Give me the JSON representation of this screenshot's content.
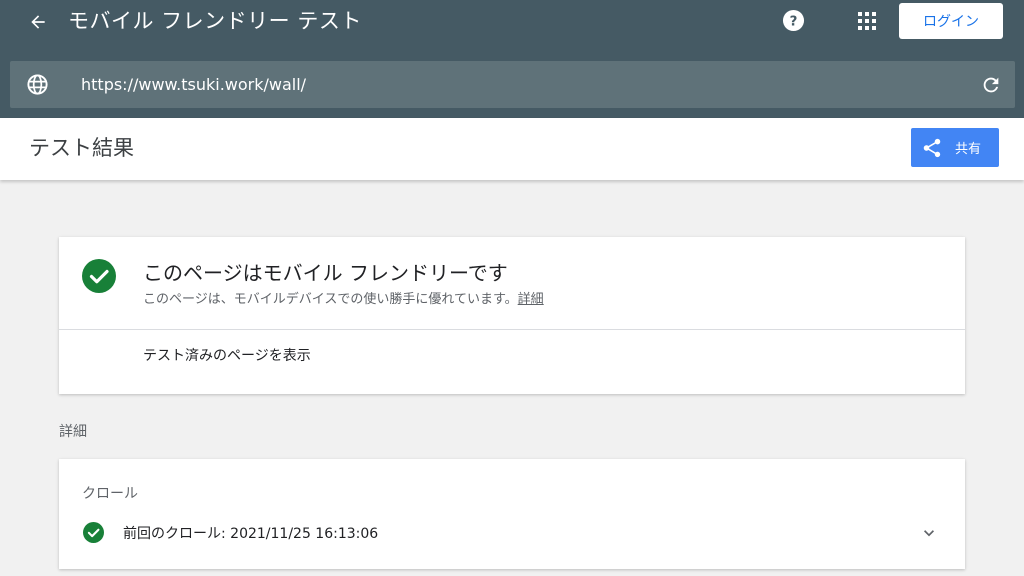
{
  "app": {
    "title": "モバイル フレンドリー テスト",
    "login_label": "ログイン",
    "icons": {
      "back": "arrow-back-icon",
      "help": "help-icon",
      "apps": "apps-grid-icon"
    }
  },
  "url_bar": {
    "url": "https://www.tsuki.work/wall/",
    "icons": {
      "globe": "globe-icon",
      "reload": "reload-icon"
    }
  },
  "result_header": {
    "title": "テスト結果",
    "share_label": "共有",
    "share_icon": "share-icon"
  },
  "summary_card": {
    "status_title": "このページはモバイル フレンドリーです",
    "status_subtitle": "このページは、モバイルデバイスでの使い勝手に優れています。",
    "details_link": "詳細",
    "view_tested_page": "テスト済みのページを表示",
    "status_icon": "check-circle-icon"
  },
  "details_section": {
    "label": "詳細"
  },
  "crawl_card": {
    "label": "クロール",
    "last_crawl": "前回のクロール: 2021/11/25 16:13:06",
    "status_icon": "check-circle-icon",
    "expand_icon": "chevron-down-icon"
  },
  "colors": {
    "topbar": "#455a64",
    "url_bar": "#5f7279",
    "accent_blue": "#4285f4",
    "success_green": "#188038",
    "background": "#f1f1f1"
  }
}
